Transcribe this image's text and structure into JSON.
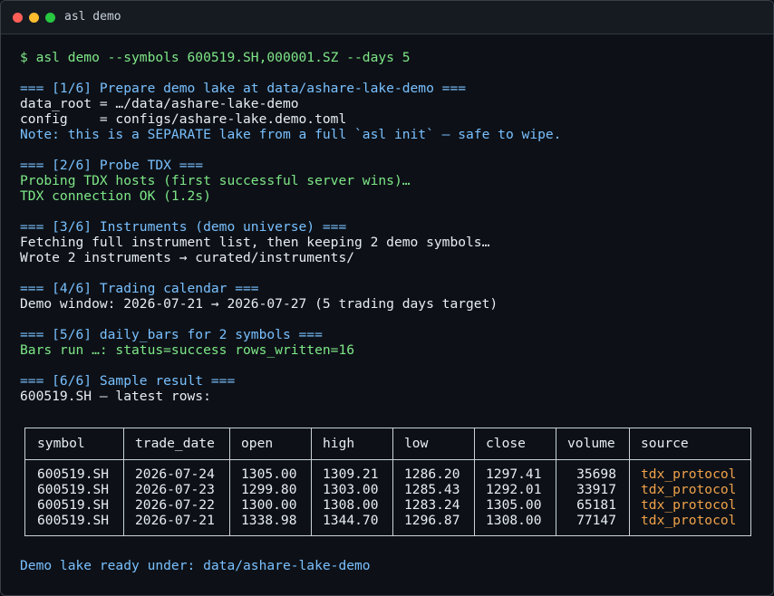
{
  "window": {
    "title": "asl demo"
  },
  "lines": [
    {
      "text": "$ asl demo --symbols 600519.SH,000001.SZ --days 5",
      "color": "green"
    },
    {
      "text": "",
      "color": "white"
    },
    {
      "text": "=== [1/6] Prepare demo lake at data/ashare-lake-demo ===",
      "color": "blue"
    },
    {
      "text": "data_root = …/data/ashare-lake-demo",
      "color": "white"
    },
    {
      "text": "config    = configs/ashare-lake.demo.toml",
      "color": "white"
    },
    {
      "text": "Note: this is a SEPARATE lake from a full `asl init` — safe to wipe.",
      "color": "blue"
    },
    {
      "text": "",
      "color": "white"
    },
    {
      "text": "=== [2/6] Probe TDX ===",
      "color": "blue"
    },
    {
      "text": "Probing TDX hosts (first successful server wins)…",
      "color": "green"
    },
    {
      "text": "TDX connection OK (1.2s)",
      "color": "green"
    },
    {
      "text": "",
      "color": "white"
    },
    {
      "text": "=== [3/6] Instruments (demo universe) ===",
      "color": "blue"
    },
    {
      "text": "Fetching full instrument list, then keeping 2 demo symbols…",
      "color": "white"
    },
    {
      "text": "Wrote 2 instruments → curated/instruments/",
      "color": "white"
    },
    {
      "text": "",
      "color": "white"
    },
    {
      "text": "=== [4/6] Trading calendar ===",
      "color": "blue"
    },
    {
      "text": "Demo window: 2026-07-21 → 2026-07-27 (5 trading days target)",
      "color": "white"
    },
    {
      "text": "",
      "color": "white"
    },
    {
      "text": "=== [5/6] daily_bars for 2 symbols ===",
      "color": "blue"
    },
    {
      "text": "Bars run …: status=success rows_written=16",
      "color": "green"
    },
    {
      "text": "",
      "color": "white"
    },
    {
      "text": "=== [6/6] Sample result ===",
      "color": "blue"
    },
    {
      "text": "600519.SH — latest rows:",
      "color": "white"
    }
  ],
  "table": {
    "headers": [
      "symbol",
      "trade_date",
      "open",
      "high",
      "low",
      "close",
      "volume",
      "source"
    ],
    "rows": [
      [
        "600519.SH",
        "2026-07-24",
        "1305.00",
        "1309.21",
        "1286.20",
        "1297.41",
        "35698",
        "tdx_protocol"
      ],
      [
        "600519.SH",
        "2026-07-23",
        "1299.80",
        "1303.00",
        "1285.43",
        "1292.01",
        "33917",
        "tdx_protocol"
      ],
      [
        "600519.SH",
        "2026-07-22",
        "1300.00",
        "1308.00",
        "1283.24",
        "1305.00",
        "65181",
        "tdx_protocol"
      ],
      [
        "600519.SH",
        "2026-07-21",
        "1338.98",
        "1344.70",
        "1296.87",
        "1308.00",
        "77147",
        "tdx_protocol"
      ]
    ]
  },
  "footer": "Demo lake ready under: data/ashare-lake-demo",
  "colors": {
    "background": "#0d1117",
    "green": "#7ee787",
    "blue": "#79c0ff",
    "orange": "#f0a14a",
    "white": "#e6edf3"
  }
}
